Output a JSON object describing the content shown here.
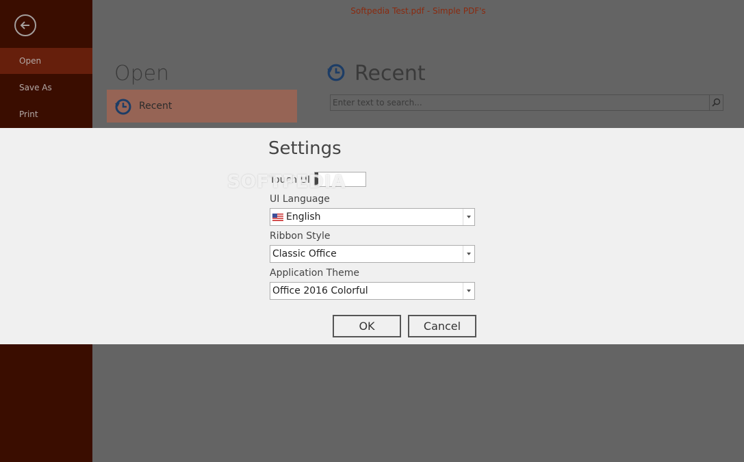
{
  "window": {
    "title": "Softpedia Test.pdf - Simple PDF's"
  },
  "sidebar": {
    "items": [
      {
        "label": "Open",
        "selected": true
      },
      {
        "label": "Save As",
        "selected": false
      },
      {
        "label": "Print",
        "selected": false
      }
    ]
  },
  "open_panel": {
    "heading": "Open",
    "recent_tile_label": "Recent"
  },
  "recent_panel": {
    "heading": "Recent",
    "search_placeholder": "Enter text to search..."
  },
  "settings": {
    "title": "Settings",
    "touch_ui_label": "Touch UI",
    "touch_ui_on": false,
    "ui_language_label": "UI Language",
    "ui_language_value": "English",
    "ribbon_style_label": "Ribbon Style",
    "ribbon_style_value": "Classic Office",
    "app_theme_label": "Application Theme",
    "app_theme_value": "Office 2016 Colorful",
    "ok_label": "OK",
    "cancel_label": "Cancel"
  },
  "watermark": "SOFTPEDIA",
  "colors": {
    "sidebar_bg": "#3a0d00",
    "sidebar_selected": "#661f0c",
    "accent": "#8a2a0f",
    "dialog_bg": "#f0f0f0"
  }
}
